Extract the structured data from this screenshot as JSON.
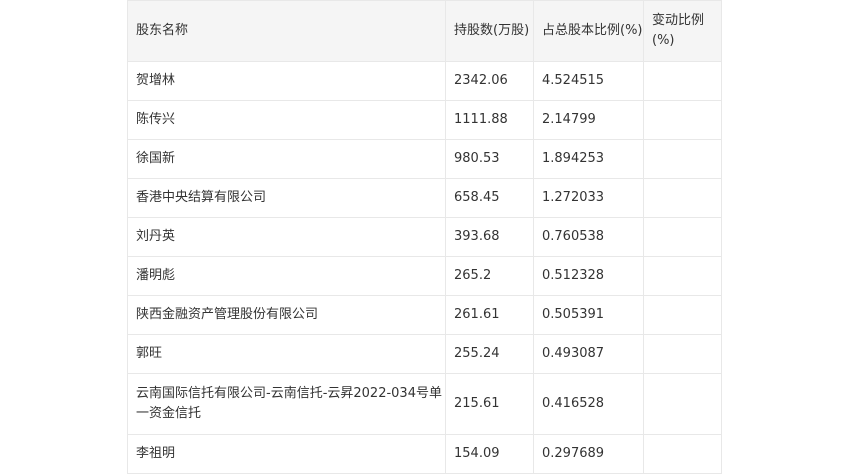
{
  "table": {
    "headers": [
      "股东名称",
      "持股数(万股)",
      "占总股本比例(%)",
      "变动比例(%)"
    ],
    "rows": [
      [
        "贺增林",
        "2342.06",
        "4.524515",
        ""
      ],
      [
        "陈传兴",
        "1111.88",
        "2.14799",
        ""
      ],
      [
        "徐国新",
        "980.53",
        "1.894253",
        ""
      ],
      [
        "香港中央结算有限公司",
        "658.45",
        "1.272033",
        ""
      ],
      [
        "刘丹英",
        "393.68",
        "0.760538",
        ""
      ],
      [
        "潘明彪",
        "265.2",
        "0.512328",
        ""
      ],
      [
        "陕西金融资产管理股份有限公司",
        "261.61",
        "0.505391",
        ""
      ],
      [
        "郭旺",
        "255.24",
        "0.493087",
        ""
      ],
      [
        "云南国际信托有限公司-云南信托-云昇2022-034号单一资金信托",
        "215.61",
        "0.416528",
        ""
      ],
      [
        "李祖明",
        "154.09",
        "0.297689",
        ""
      ]
    ]
  }
}
